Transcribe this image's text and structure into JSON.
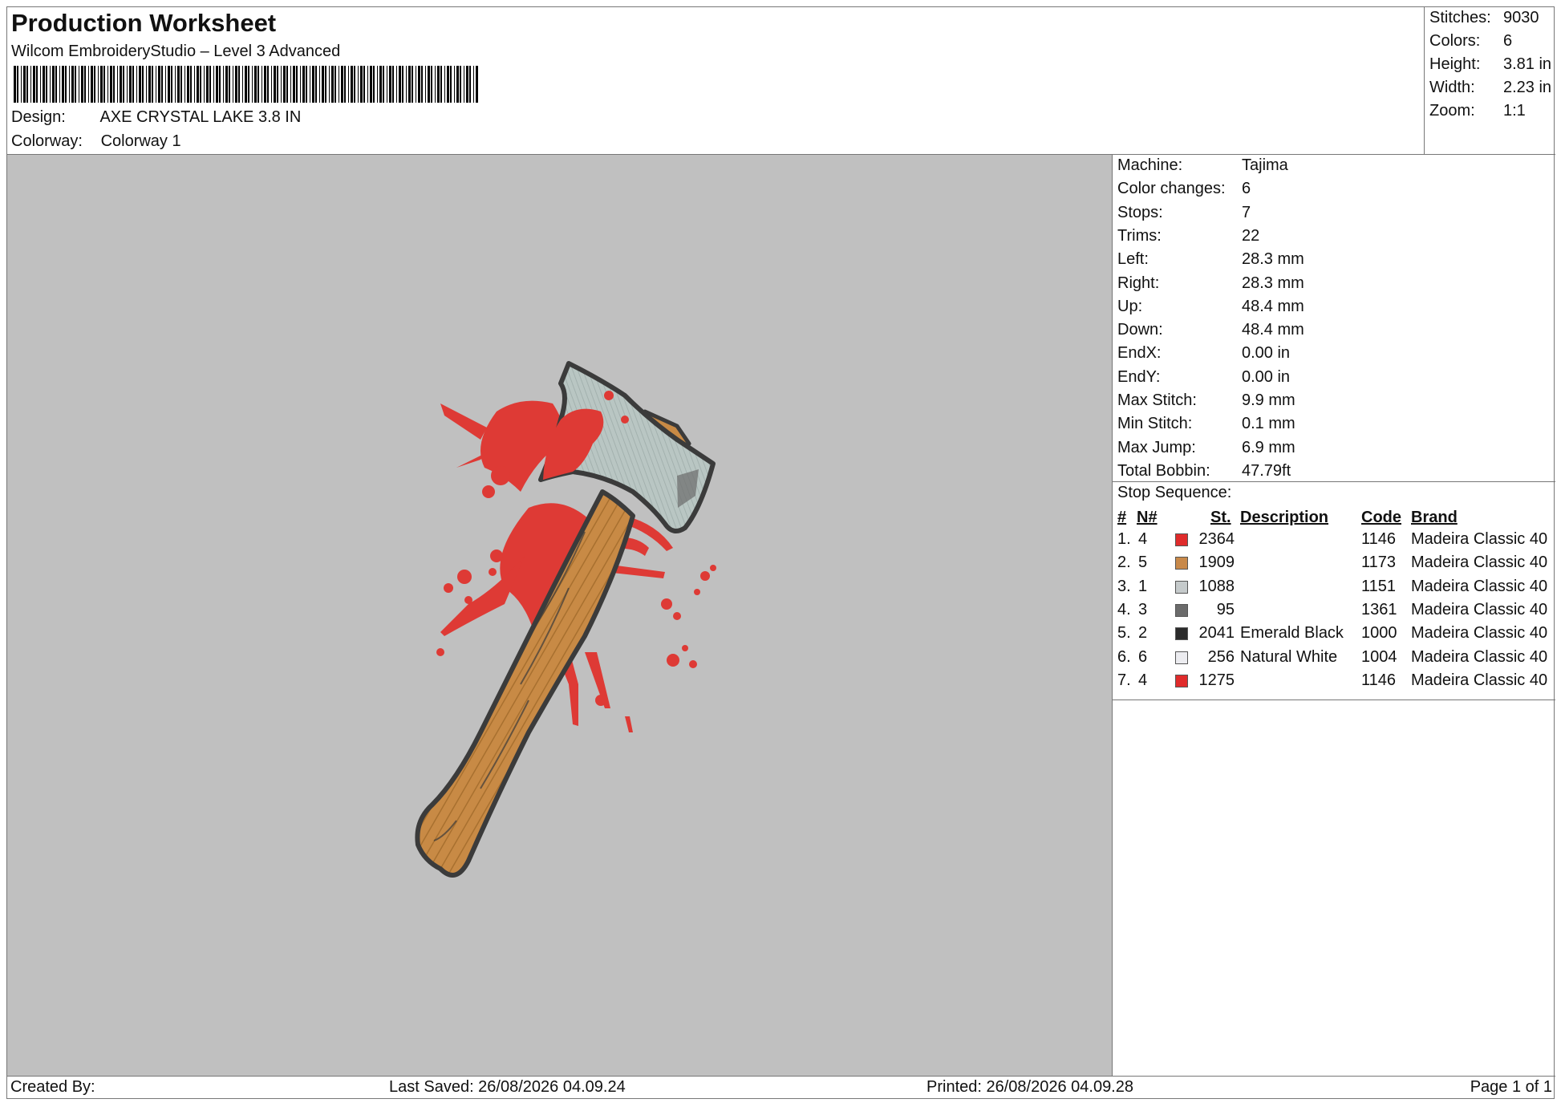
{
  "header": {
    "title": "Production Worksheet",
    "subtitle": "Wilcom EmbroideryStudio – Level 3 Advanced",
    "design_label": "Design:",
    "design_value": "AXE CRYSTAL LAKE 3.8 IN",
    "colorway_label": "Colorway:",
    "colorway_value": "Colorway 1"
  },
  "stats": [
    {
      "label": "Stitches:",
      "value": "9030"
    },
    {
      "label": "Colors:",
      "value": "6"
    },
    {
      "label": "Height:",
      "value": "3.81 in"
    },
    {
      "label": "Width:",
      "value": "2.23 in"
    },
    {
      "label": "Zoom:",
      "value": "1:1"
    }
  ],
  "machine_info": [
    {
      "label": "Machine:",
      "value": "Tajima"
    },
    {
      "label": "Color changes:",
      "value": "6"
    },
    {
      "label": "Stops:",
      "value": "7"
    },
    {
      "label": "Trims:",
      "value": "22"
    },
    {
      "label": "Left:",
      "value": "28.3 mm"
    },
    {
      "label": "Right:",
      "value": "28.3 mm"
    },
    {
      "label": "Up:",
      "value": "48.4 mm"
    },
    {
      "label": "Down:",
      "value": "48.4 mm"
    },
    {
      "label": "EndX:",
      "value": "0.00 in"
    },
    {
      "label": "EndY:",
      "value": "0.00 in"
    },
    {
      "label": "Max Stitch:",
      "value": "9.9 mm"
    },
    {
      "label": "Min Stitch:",
      "value": "0.1 mm"
    },
    {
      "label": "Max Jump:",
      "value": "6.9 mm"
    },
    {
      "label": "Total Bobbin:",
      "value": "47.79ft"
    }
  ],
  "stop_sequence": {
    "title": "Stop Sequence:",
    "headers": {
      "num": "#",
      "n": "N#",
      "st": "St.",
      "description": "Description",
      "code": "Code",
      "brand": "Brand"
    },
    "rows": [
      {
        "num": "1.",
        "n": "4",
        "color": "#e02b2b",
        "st": "2364",
        "description": "",
        "code": "1146",
        "brand": "Madeira Classic 40"
      },
      {
        "num": "2.",
        "n": "5",
        "color": "#c8894a",
        "st": "1909",
        "description": "",
        "code": "1173",
        "brand": "Madeira Classic 40"
      },
      {
        "num": "3.",
        "n": "1",
        "color": "#c5cacb",
        "st": "1088",
        "description": "",
        "code": "1151",
        "brand": "Madeira Classic 40"
      },
      {
        "num": "4.",
        "n": "3",
        "color": "#6b6b6b",
        "st": "95",
        "description": "",
        "code": "1361",
        "brand": "Madeira Classic 40"
      },
      {
        "num": "5.",
        "n": "2",
        "color": "#2b2b2b",
        "st": "2041",
        "description": "Emerald Black",
        "code": "1000",
        "brand": "Madeira Classic 40"
      },
      {
        "num": "6.",
        "n": "6",
        "color": "#ececf0",
        "st": "256",
        "description": "Natural White",
        "code": "1004",
        "brand": "Madeira Classic 40"
      },
      {
        "num": "7.",
        "n": "4",
        "color": "#e02b2b",
        "st": "1275",
        "description": "",
        "code": "1146",
        "brand": "Madeira Classic 40"
      }
    ]
  },
  "footer": {
    "created_by": "Created By:",
    "last_saved": "Last Saved: 26/08/2026 04.09.24",
    "printed": "Printed: 26/08/2026 04.09.28",
    "page": "Page 1 of 1"
  }
}
